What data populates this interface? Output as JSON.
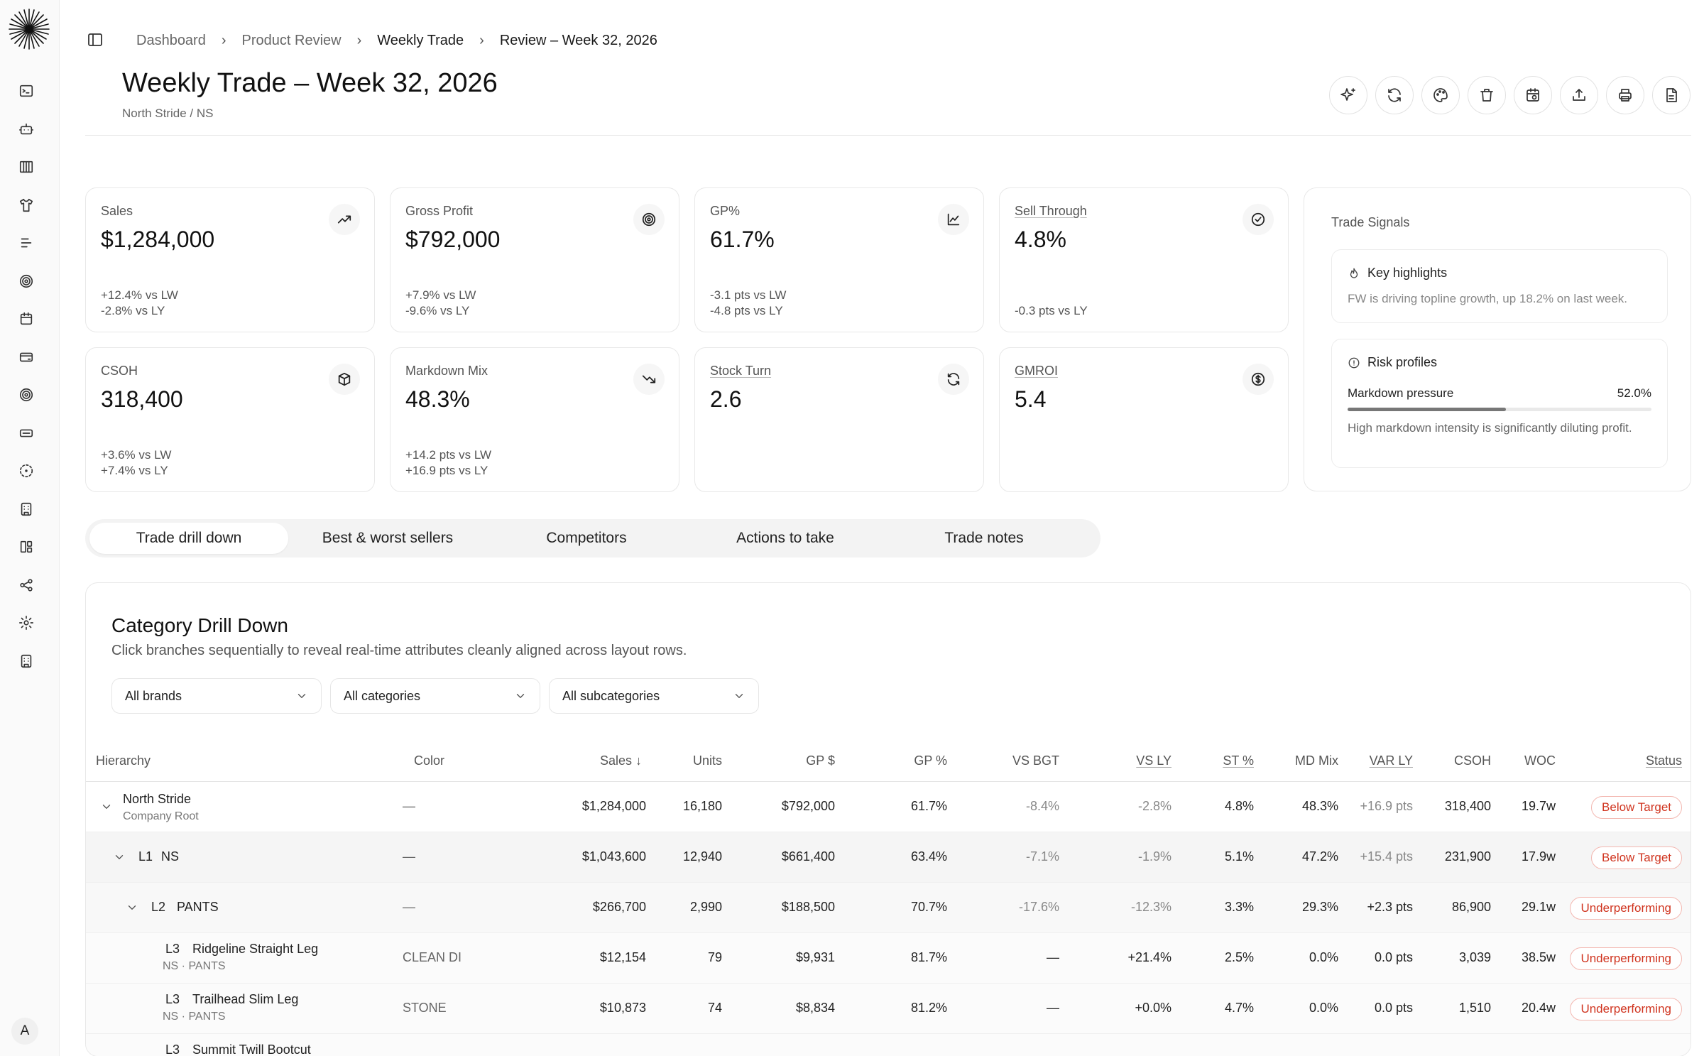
{
  "breadcrumbs": [
    "Dashboard",
    "Product Review",
    "Weekly Trade",
    "Review – Week 32, 2026"
  ],
  "page": {
    "title": "Weekly Trade – Week 32, 2026",
    "subtitle": "North Stride / NS"
  },
  "toolbar": [
    "sparkle-icon",
    "refresh-icon",
    "palette-icon",
    "trash-icon",
    "calendar-icon",
    "upload-icon",
    "print-icon",
    "document-icon"
  ],
  "sidebar": {
    "icons": [
      "terminal-icon",
      "bot-icon",
      "columns-icon",
      "shirt-icon",
      "list-icon",
      "target-icon",
      "calendar-icon",
      "card-icon",
      "target-icon",
      "ticket-icon",
      "dashed-circle-icon",
      "building-icon",
      "layout-icon",
      "share-icon",
      "gear-icon",
      "building-icon"
    ],
    "avatar": "A"
  },
  "kpis": [
    {
      "label": "Sales",
      "value": "$1,284,000",
      "d1": "+12.4% vs LW",
      "d2": "-2.8% vs LY",
      "icon": "trend-up-icon",
      "underline": false
    },
    {
      "label": "Gross Profit",
      "value": "$792,000",
      "d1": "+7.9% vs LW",
      "d2": "-9.6% vs LY",
      "icon": "target-icon",
      "underline": false
    },
    {
      "label": "GP%",
      "value": "61.7%",
      "d1": "-3.1 pts vs LW",
      "d2": "-4.8 pts vs LY",
      "icon": "chart-icon",
      "underline": false
    },
    {
      "label": "Sell Through",
      "value": "4.8%",
      "d1": "",
      "d2": "-0.3 pts vs LY",
      "icon": "check-circle-icon",
      "underline": true
    },
    {
      "label": "CSOH",
      "value": "318,400",
      "d1": "+3.6% vs LW",
      "d2": "+7.4% vs LY",
      "icon": "box-icon",
      "underline": false
    },
    {
      "label": "Markdown Mix",
      "value": "48.3%",
      "d1": "+14.2 pts vs LW",
      "d2": "+16.9 pts vs LY",
      "icon": "trend-down-icon",
      "underline": false
    },
    {
      "label": "Stock Turn",
      "value": "2.6",
      "d1": "",
      "d2": "",
      "icon": "refresh-icon",
      "underline": true
    },
    {
      "label": "GMROI",
      "value": "5.4",
      "d1": "",
      "d2": "",
      "icon": "dollar-circle-icon",
      "underline": true
    }
  ],
  "signals": {
    "title": "Trade Signals",
    "highlights": {
      "label": "Key highlights",
      "text": "FW is driving topline growth, up 18.2% on last week."
    },
    "risk": {
      "label": "Risk profiles",
      "metric": "Markdown pressure",
      "value": "52.0%",
      "level": 0.52,
      "text": "High markdown intensity is significantly diluting profit."
    }
  },
  "tabs": [
    "Trade drill down",
    "Best & worst sellers",
    "Competitors",
    "Actions to take",
    "Trade notes"
  ],
  "drill": {
    "title": "Category Drill Down",
    "subtitle": "Click branches sequentially to reveal real-time attributes cleanly aligned across layout rows.",
    "filters": [
      "All brands",
      "All categories",
      "All subcategories"
    ]
  },
  "table": {
    "headers": {
      "hierarchy": "Hierarchy",
      "color": "Color",
      "sales": "Sales ↓",
      "units": "Units",
      "gp": "GP $",
      "gpp": "GP %",
      "vsbgt": "VS BGT",
      "vsly": "VS LY",
      "st": "ST %",
      "md": "MD Mix",
      "varly": "VAR LY",
      "csoh": "CSOH",
      "woc": "WOC",
      "status": "Status"
    },
    "rows": [
      {
        "level": "",
        "name": "North Stride",
        "sub": "Company Root",
        "color": "—",
        "sales": "$1,284,000",
        "units": "16,180",
        "gp": "$792,000",
        "gpp": "61.7%",
        "vsbgt": "-8.4%",
        "vsly": "-2.8%",
        "st": "4.8%",
        "md": "48.3%",
        "varly": "+16.9 pts",
        "csoh": "318,400",
        "woc": "19.7w",
        "status": "Below Target"
      },
      {
        "level": "L1",
        "name": "NS",
        "sub": "",
        "color": "—",
        "sales": "$1,043,600",
        "units": "12,940",
        "gp": "$661,400",
        "gpp": "63.4%",
        "vsbgt": "-7.1%",
        "vsly": "-1.9%",
        "st": "5.1%",
        "md": "47.2%",
        "varly": "+15.4 pts",
        "csoh": "231,900",
        "woc": "17.9w",
        "status": "Below Target"
      },
      {
        "level": "L2",
        "name": "PANTS",
        "sub": "",
        "color": "—",
        "sales": "$266,700",
        "units": "2,990",
        "gp": "$188,500",
        "gpp": "70.7%",
        "vsbgt": "-17.6%",
        "vsly": "-12.3%",
        "st": "3.3%",
        "md": "29.3%",
        "varly": "+2.3 pts",
        "csoh": "86,900",
        "woc": "29.1w",
        "status": "Underperforming"
      },
      {
        "level": "L3",
        "name": "Ridgeline Straight Leg",
        "sub": "NS · PANTS",
        "color": "CLEAN DI",
        "sales": "$12,154",
        "units": "79",
        "gp": "$9,931",
        "gpp": "81.7%",
        "vsbgt": "—",
        "vsly": "+21.4%",
        "st": "2.5%",
        "md": "0.0%",
        "varly": "0.0 pts",
        "csoh": "3,039",
        "woc": "38.5w",
        "status": "Underperforming"
      },
      {
        "level": "L3",
        "name": "Trailhead Slim Leg",
        "sub": "NS · PANTS",
        "color": "STONE",
        "sales": "$10,873",
        "units": "74",
        "gp": "$8,834",
        "gpp": "81.2%",
        "vsbgt": "—",
        "vsly": "+0.0%",
        "st": "4.7%",
        "md": "0.0%",
        "varly": "0.0 pts",
        "csoh": "1,510",
        "woc": "20.4w",
        "status": "Underperforming"
      },
      {
        "level": "L3",
        "name": "Summit Twill Bootcut",
        "sub": "",
        "color": "",
        "sales": "",
        "units": "",
        "gp": "",
        "gpp": "",
        "vsbgt": "",
        "vsly": "",
        "st": "",
        "md": "",
        "varly": "",
        "csoh": "",
        "woc": "",
        "status": ""
      }
    ]
  }
}
